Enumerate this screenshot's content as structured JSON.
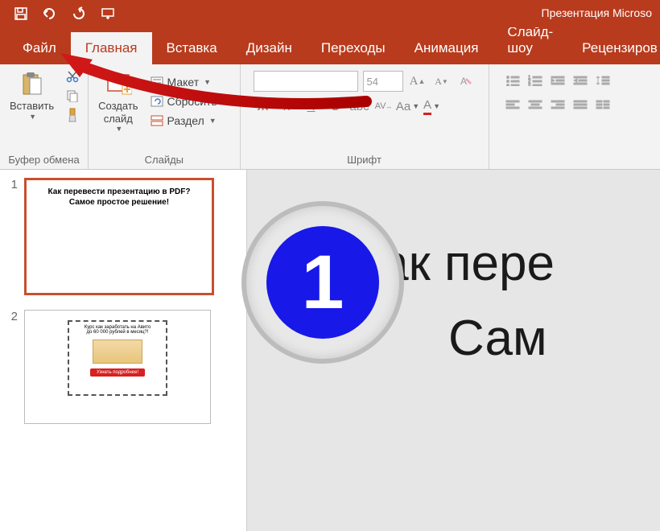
{
  "title": "Презентация Microso",
  "tabs": {
    "file": "Файл",
    "home": "Главная",
    "insert": "Вставка",
    "design": "Дизайн",
    "transitions": "Переходы",
    "animations": "Анимация",
    "slideshow": "Слайд-шоу",
    "review": "Рецензиров"
  },
  "groups": {
    "clipboard": {
      "label": "Буфер обмена",
      "paste": "Вставить"
    },
    "slides": {
      "label": "Слайды",
      "new_slide": "Создать\nслайд",
      "layout": "Макет",
      "reset": "Сбросить",
      "section": "Раздел"
    },
    "font": {
      "label": "Шрифт",
      "size_value": "54"
    },
    "paragraph": {
      "label": ""
    }
  },
  "thumbs": {
    "s1": {
      "num": "1",
      "title1": "Как перевести презентацию в PDF?",
      "title2": "Самое простое решение!"
    },
    "s2": {
      "num": "2",
      "hdr": "Курс как заработать на Авито\nдо 60 000 рублей в месяц?!",
      "btn": "Узнать подробнее!"
    }
  },
  "main_slide": {
    "line1": "Как пере",
    "line2": "Сам"
  },
  "step": "1"
}
